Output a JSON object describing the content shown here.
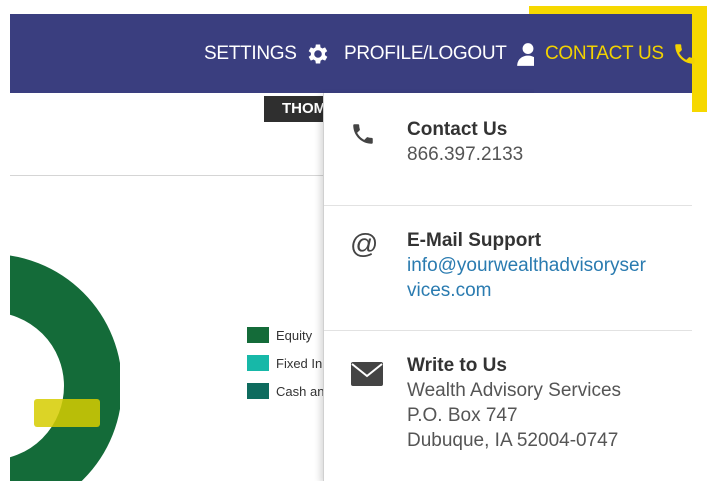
{
  "nav": {
    "settings_label": "SETTINGS",
    "settings_icon": "gear-icon",
    "profile_label": "PROFILE/LOGOUT",
    "profile_icon": "user-icon",
    "contact_label": "CONTACT US",
    "contact_icon": "phone-icon"
  },
  "user_tag": "THOM",
  "legend": [
    {
      "label": "Equity",
      "color": "#146b39"
    },
    {
      "label": "Fixed In",
      "color": "#17b8a8"
    },
    {
      "label": "Cash an",
      "color": "#0e6b5e"
    }
  ],
  "dropdown": {
    "phone": {
      "title": "Contact Us",
      "value": "866.397.2133",
      "icon": "phone-icon"
    },
    "email": {
      "title": "E-Mail Support",
      "value_line1": "info@yourwealthadvisoryser",
      "value_line2": "vices.com",
      "icon": "at-icon"
    },
    "mail": {
      "title": "Write to Us",
      "line1": "Wealth Advisory Services",
      "line2": "P.O. Box 747",
      "line3": "Dubuque, IA 52004-0747",
      "icon": "envelope-icon"
    }
  },
  "colors": {
    "navbar": "#3a3e7f",
    "highlight": "#f6d800",
    "contact_text": "#f2d200",
    "chart_green": "#146b39",
    "link": "#2a7bb0"
  }
}
